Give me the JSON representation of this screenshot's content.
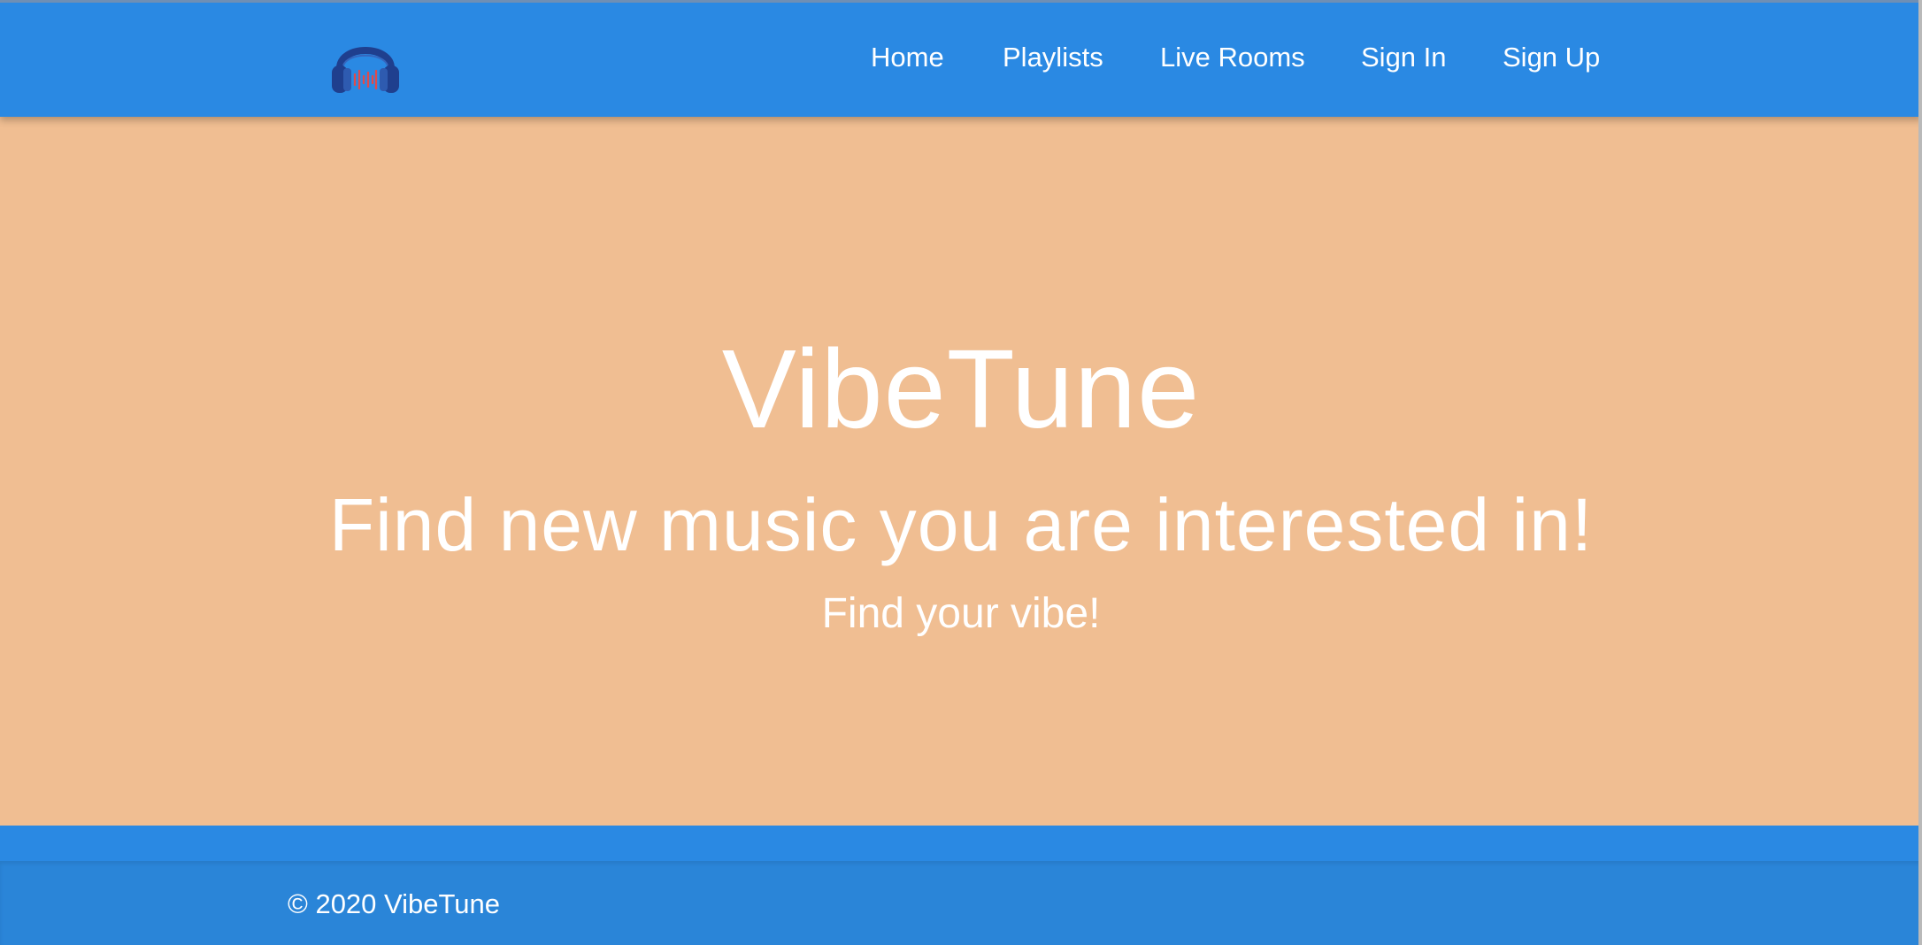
{
  "colors": {
    "nav_background": "#2a89e3",
    "hero_background": "#f0be92",
    "footer_background": "#2a89e3",
    "text": "#ffffff",
    "logo_primary": "#1f3f8e",
    "logo_accent": "#e24a4a"
  },
  "header": {
    "logo_icon": "headphones-sound-wave-icon",
    "nav": {
      "home": "Home",
      "playlists": "Playlists",
      "live_rooms": "Live Rooms",
      "sign_in": "Sign In",
      "sign_up": "Sign Up"
    }
  },
  "hero": {
    "title": "VibeTune",
    "subtitle": "Find new music you are interested in!",
    "tagline": "Find your vibe!"
  },
  "footer": {
    "copyright": "© 2020 VibeTune"
  }
}
